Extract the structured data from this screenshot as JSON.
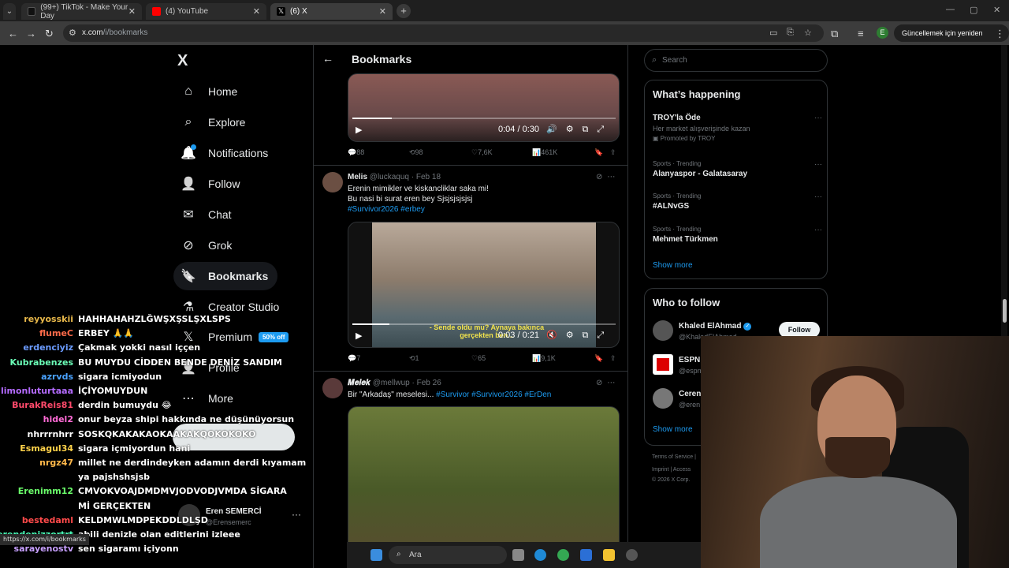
{
  "browser": {
    "tabs": [
      {
        "title": "(99+) TikTok - Make Your Day",
        "color": "#111111"
      },
      {
        "title": "(4) YouTube",
        "color": "#ff0000"
      },
      {
        "title": "(6) X",
        "color": "#000000"
      }
    ],
    "url_host": "x.com",
    "url_path": "/i/bookmarks",
    "profile_initial": "E",
    "update_label": "Güncellemek için yeniden başlat"
  },
  "sidebar": {
    "logo": "X",
    "items": [
      {
        "label": "Home",
        "icon": "home-icon",
        "glyph": "⌂"
      },
      {
        "label": "Explore",
        "icon": "search-icon",
        "glyph": "⌕"
      },
      {
        "label": "Notifications",
        "icon": "bell-icon",
        "glyph": "🔔"
      },
      {
        "label": "Follow",
        "icon": "add-user-icon",
        "glyph": "👤"
      },
      {
        "label": "Chat",
        "icon": "mail-icon",
        "glyph": "✉"
      },
      {
        "label": "Grok",
        "icon": "grok-icon",
        "glyph": "⊘"
      },
      {
        "label": "Bookmarks",
        "icon": "bookmark-icon",
        "glyph": "🔖"
      },
      {
        "label": "Creator Studio",
        "icon": "flask-icon",
        "glyph": "⚗"
      },
      {
        "label": "Premium",
        "icon": "x-premium-icon",
        "glyph": "𝕏"
      },
      {
        "label": "Profile",
        "icon": "profile-icon",
        "glyph": "👤"
      },
      {
        "label": "More",
        "icon": "more-circle-icon",
        "glyph": "⋯"
      }
    ],
    "premium_badge": "50% off",
    "profile": {
      "name": "Eren SEMERCİ",
      "handle": "@Erensemerc"
    }
  },
  "center": {
    "title": "Bookmarks",
    "tweet1": {
      "time": "0:04 / 0:30",
      "progress": 0.15,
      "replies": "88",
      "retweets": "98",
      "likes": "7,6K",
      "views": "461K"
    },
    "tweet2": {
      "name": "Melis",
      "handle": "@luckaquq",
      "date": "· Feb 18",
      "line1": "Erenin mimikler ve kiskancliklar saka mi!",
      "line2": "Bu nasi bi surat eren bey Sjsjsjsjsjsj",
      "tags": "#Survivor2026 #erbey",
      "subtitle": "- Sende oldu mu? Aynaya bakınca gerçekten ben...",
      "time": "0:03 / 0:21",
      "progress": 0.14,
      "replies": "7",
      "retweets": "1",
      "likes": "65",
      "views": "9,1K"
    },
    "tweet3": {
      "name": "𝑴𝒆𝒍𝒆𝒌",
      "handle": "@mellwup",
      "date": "· Feb 26",
      "text": "Bir \"Arkadaş\" meselesi...",
      "tags": "#Survivor #Survivor2026 #ErDen"
    }
  },
  "right": {
    "search_placeholder": "Search",
    "happening_title": "What’s happening",
    "trends": [
      {
        "meta": "",
        "name": "TROY'la Öde",
        "desc": "Her market alışverişinde kazan",
        "promo": "Promoted by TROY"
      },
      {
        "meta": "Sports · Trending",
        "name": "Alanyaspor - Galatasaray"
      },
      {
        "meta": "Sports · Trending",
        "name": "#ALNvGS"
      },
      {
        "meta": "Sports · Trending",
        "name": "Mehmet Türkmen"
      }
    ],
    "show_more": "Show more",
    "wtf_title": "Who to follow",
    "wtf": [
      {
        "name": "Khaled ElAhmad",
        "handle": "@KhaledElAhmad"
      },
      {
        "name": "ESPN",
        "handle": "@espn"
      },
      {
        "name": "Ceren",
        "handle": "@eren"
      }
    ],
    "follow_label": "Follow",
    "footer1": "Terms of Service |",
    "footer2": "Imprint | Access",
    "footer3": "© 2026 X Corp."
  },
  "chat": [
    {
      "user": "reyyosskii",
      "color": "#e8b84a",
      "msg": "HAHHAHAHZLĞWŞXŞSLŞXLSPS"
    },
    {
      "user": "flumeC",
      "color": "#ff6b4a",
      "msg": "ERBEY 🙏🙏"
    },
    {
      "user": "erdenciyiz",
      "color": "#6b9bff",
      "msg": "Çakmak yokki nasıl iççen"
    },
    {
      "user": "Kubrabenzes",
      "color": "#6bffb8",
      "msg": "BU MUYDU CİDDEN BENDE DENİZ SANDIM"
    },
    {
      "user": "azrvds",
      "color": "#4aa3ff",
      "msg": "sigara icmiyodun"
    },
    {
      "user": "limonluturtaaa",
      "color": "#b46bff",
      "msg": "İÇİYOMUYDUN"
    },
    {
      "user": "BurakReis81",
      "color": "#ff4a6b",
      "msg": "derdin bumuydu 😂"
    },
    {
      "user": "hidel2",
      "color": "#ff6bd6",
      "msg": "onur beyza shipi hakkında ne düşünüyorsun"
    },
    {
      "user": "nhrrrnhrr",
      "color": "#ffffff",
      "msg": "SOSKQKAKAKAOKAAKAKQOKOKOKO"
    },
    {
      "user": "Esmagul34",
      "color": "#ffd24a",
      "msg": "sigara içmiyordun hani"
    },
    {
      "user": "nrgz47",
      "color": "#ffb84a",
      "msg": "millet ne derdindeyken adamın derdi kıyamam"
    },
    {
      "user": "",
      "color": "#ffffff",
      "msg": "ya pajshshsjsb"
    },
    {
      "user": "Erenimm12",
      "color": "#6bff6b",
      "msg": "CMVOKVOAJDMDMVJODVODJVMDA SİGARA"
    },
    {
      "user": "",
      "color": "#ffffff",
      "msg": "Mİ GERÇEKTEN"
    },
    {
      "user": "bestedaml",
      "color": "#ff4a4a",
      "msg": "KELDMWLMDPEKDDLDLŞD"
    },
    {
      "user": "erendenizzortrt",
      "color": "#4affb8",
      "msg": "abili denizle olan editlerini izleee"
    },
    {
      "user": "sarayenostv",
      "color": "#c8a0ff",
      "msg": "sen sigaramı içiyonn"
    }
  ],
  "status_url": "https://x.com/i/bookmarks",
  "taskbar": {
    "search_placeholder": "Ara"
  }
}
